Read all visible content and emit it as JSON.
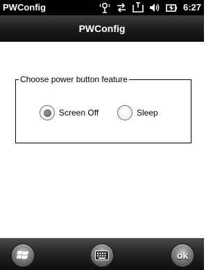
{
  "status_bar": {
    "app_name": "PWConfig",
    "time": "6:27",
    "icons": [
      "connectivity-icon",
      "sync-icon",
      "message-icon",
      "volume-icon",
      "battery-icon"
    ]
  },
  "title_bar": {
    "title": "PWConfig"
  },
  "group": {
    "legend": "Choose power button feature",
    "options": [
      {
        "label": "Screen Off",
        "selected": true
      },
      {
        "label": "Sleep",
        "selected": false
      }
    ]
  },
  "bottom_bar": {
    "start_icon": "windows-start-icon",
    "keyboard_icon": "keyboard-icon",
    "ok_label": "ok"
  },
  "colors": {
    "status_bar_bg": "#000000",
    "title_bar_bg": "#1c1c1c",
    "content_bg": "#ffffff",
    "bottom_bar_bg": "#262626"
  }
}
